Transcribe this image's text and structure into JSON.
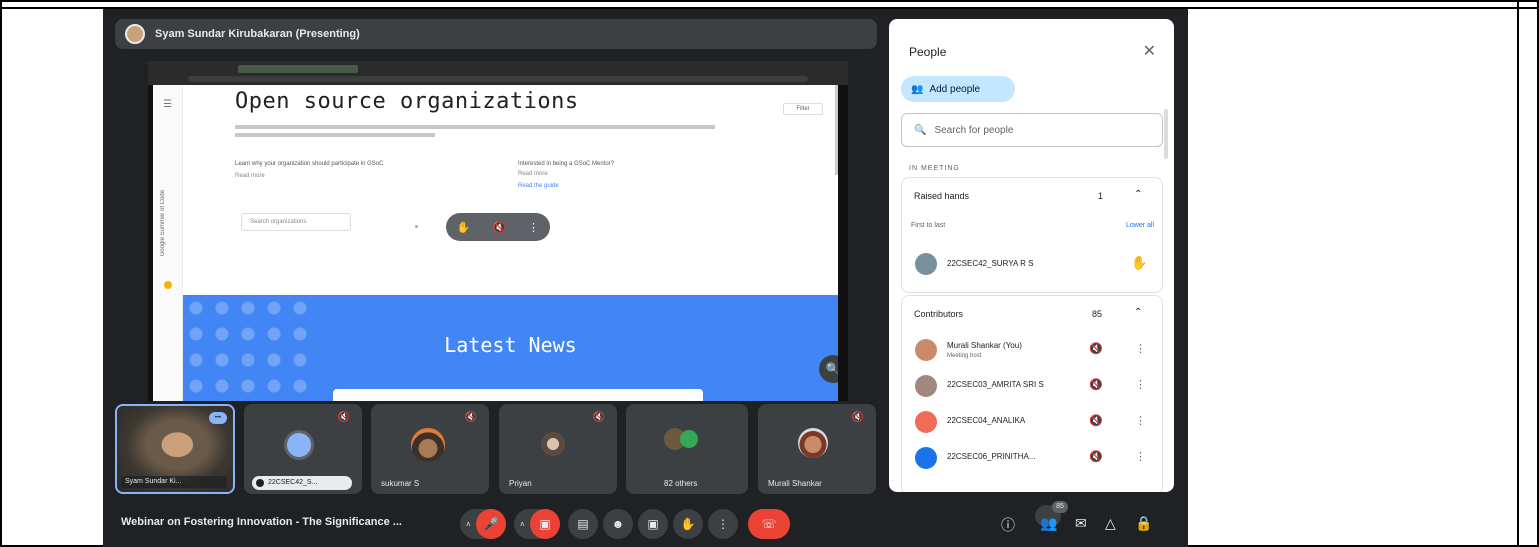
{
  "presenter": {
    "name": "Syam Sundar Kirubakaran (Presenting)"
  },
  "shared_screen": {
    "page_title": "Open source organizations",
    "latest_news": "Latest News",
    "side_text": "Google Summer of Code",
    "menu_icon": "menu-icon",
    "link_left": "Learn why your organization should participate in GSoC",
    "link_left_sub": "Read more",
    "link_right": "Interested in being a GSoC Mentor?",
    "link_right_sub": "Read more",
    "link_right_link": "Read the guide",
    "search_placeholder": "Search organizations",
    "badge": "Filter"
  },
  "tiles": [
    {
      "name": "Syam Sundar Ki...",
      "type": "self"
    },
    {
      "name": "22CSEC42_S...",
      "type": "initial"
    },
    {
      "name": "sukumar S",
      "type": "avatar"
    },
    {
      "name": "Priyan",
      "type": "avatar"
    },
    {
      "name": "82 others",
      "type": "others"
    },
    {
      "name": "Murali Shankar",
      "type": "avatar"
    }
  ],
  "bottom_bar": {
    "meeting_title": "Webinar on Fostering Innovation - The Significance ...",
    "people_count": "85"
  },
  "people_panel": {
    "title": "People",
    "add_people": "Add people",
    "search_placeholder": "Search for people",
    "section_label": "IN MEETING",
    "raised_hands": {
      "label": "Raised hands",
      "count": "1"
    },
    "first_to_last": "First to last",
    "lower_all": "Lower all",
    "raised_person": {
      "name": "22CSEC42_SURYA R S"
    },
    "contributors": {
      "label": "Contributors",
      "count": "85"
    },
    "participants": [
      {
        "name": "Murali Shankar (You)",
        "sub": "Meeting host"
      },
      {
        "name": "22CSEC03_AMRITA SRI S"
      },
      {
        "name": "22CSEC04_ANALIKA"
      },
      {
        "name": "22CSEC06_PRINITHA..."
      }
    ]
  },
  "colors": {
    "meet_bg": "#202124",
    "tile_bg": "#3c4043",
    "end_call_red": "#ea4335",
    "banner_blue": "#4285f4",
    "add_people_bg": "#c2e7ff"
  }
}
